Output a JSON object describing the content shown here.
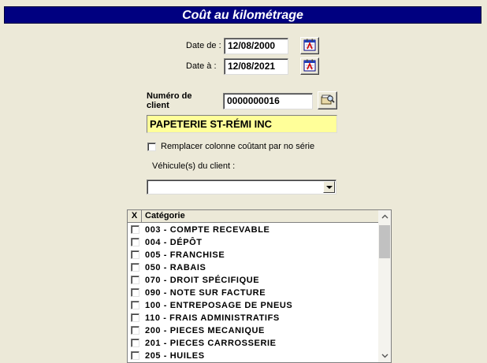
{
  "title": "Coût au kilométrage",
  "date_from": {
    "label": "Date de :",
    "value": "12/08/2000"
  },
  "date_to": {
    "label": "Date à :",
    "value": "12/08/2021"
  },
  "client": {
    "number_label_line1": "Numéro de",
    "number_label_line2": "client",
    "number_value": "0000000016",
    "name": "PAPETERIE ST-RÉMI INC"
  },
  "replace_option": {
    "label": "Remplacer colonne coûtant par no série",
    "checked": false
  },
  "vehicles": {
    "label": "Véhicule(s) du client :",
    "selected": ""
  },
  "categories": {
    "header_check": "X",
    "header_label": "Catégorie",
    "items": [
      "003 - COMPTE RECEVABLE",
      "004 - DÉPÔT",
      "005 - FRANCHISE",
      "050 - RABAIS",
      "070 - DROIT SPÉCIFIQUE",
      "090 - NOTE SUR FACTURE",
      "100 - ENTREPOSAGE DE PNEUS",
      "110 - FRAIS ADMINISTRATIFS",
      "200 - PIECES MECANIQUE",
      "201 - PIECES CARROSSERIE",
      "205 - HUILES"
    ]
  },
  "icons": {
    "calendar": "calendar-icon",
    "lookup": "client-lookup-icon"
  }
}
